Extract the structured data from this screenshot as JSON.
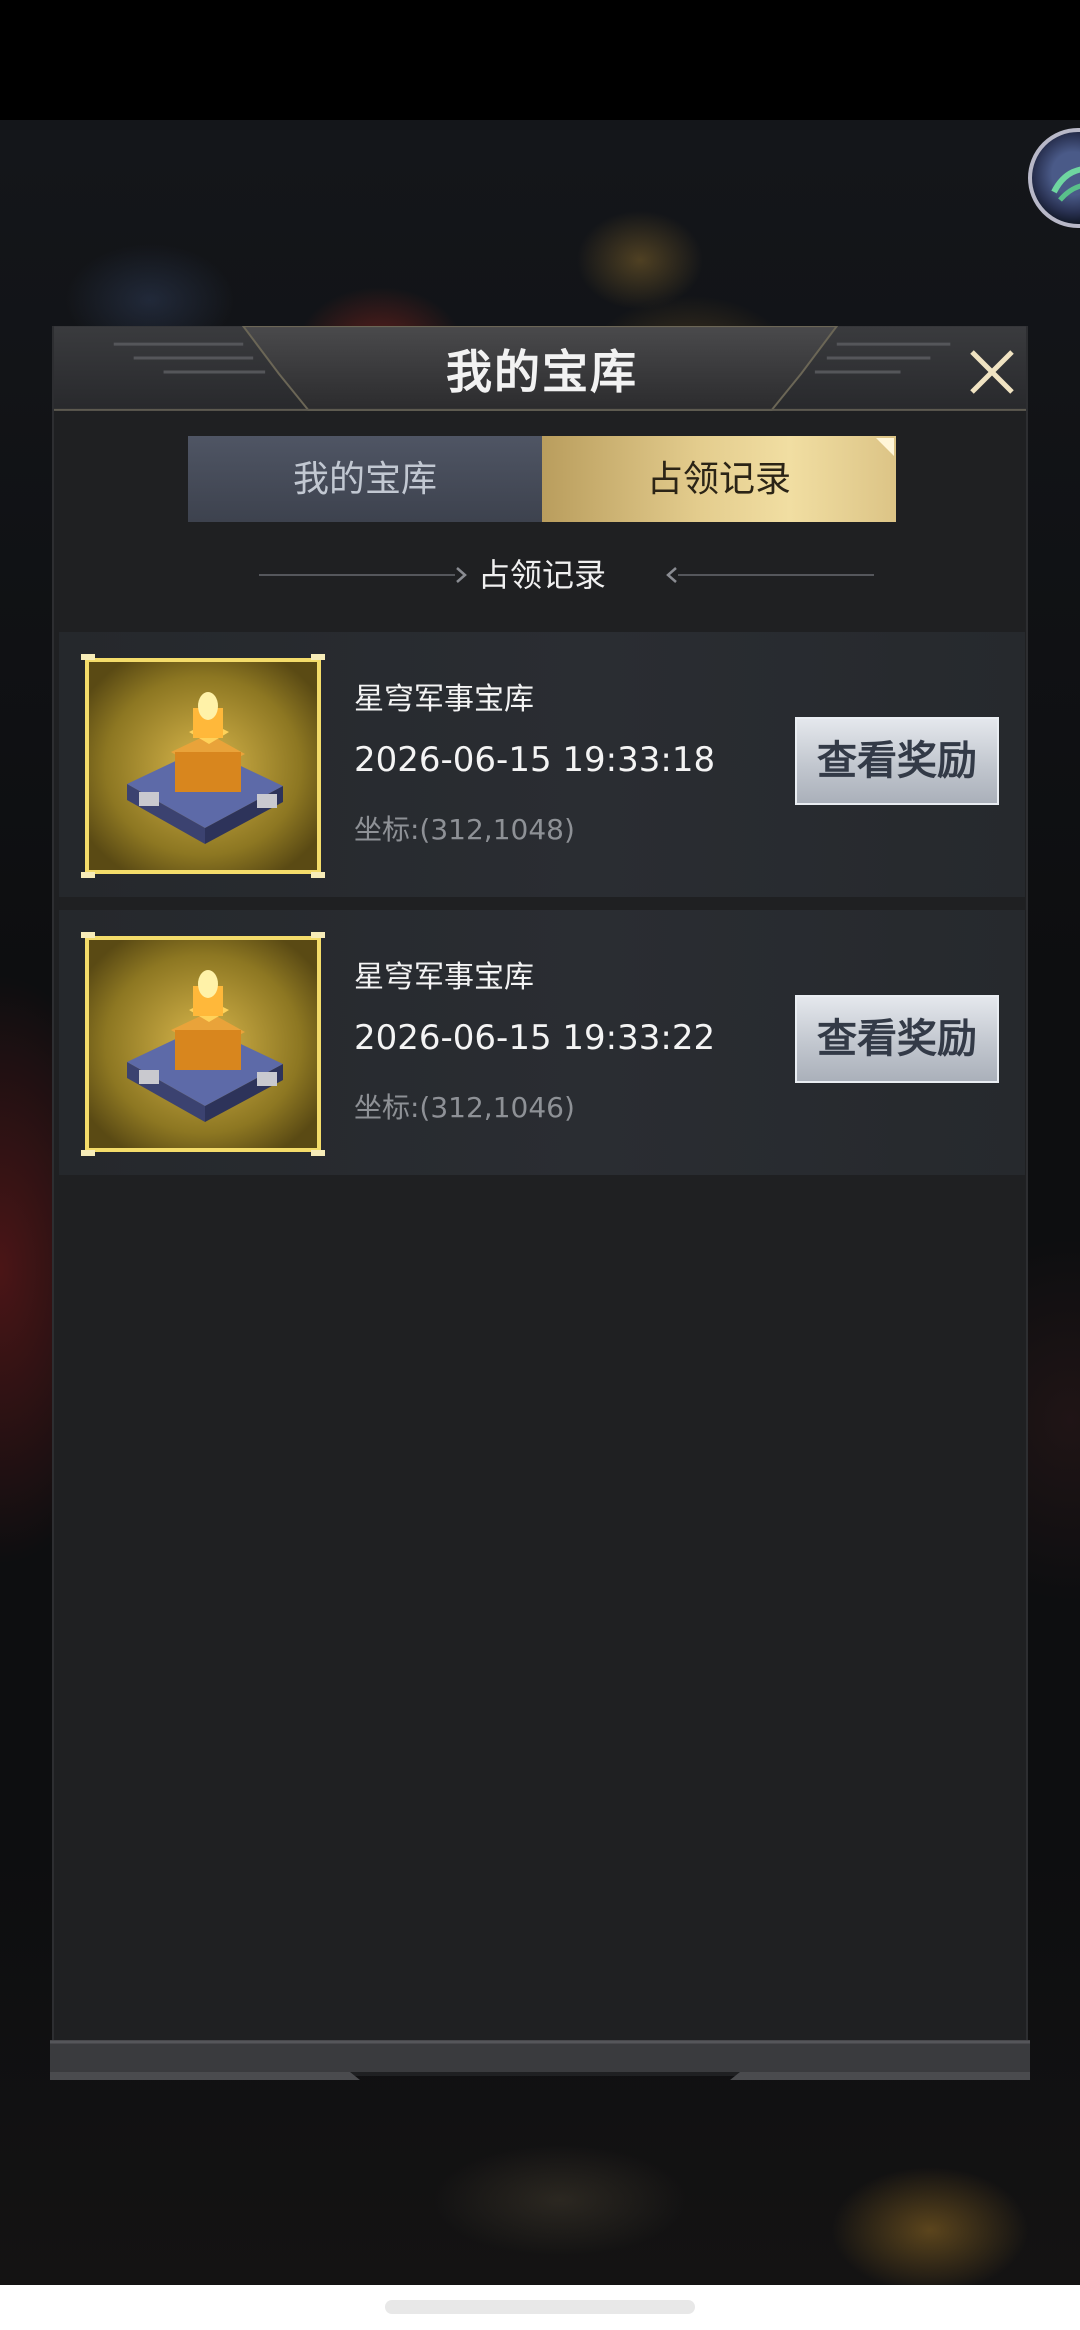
{
  "dialog": {
    "title": "我的宝库",
    "tabs": [
      {
        "label": "我的宝库",
        "active": false
      },
      {
        "label": "占领记录",
        "active": true
      }
    ],
    "section_heading": "占领记录"
  },
  "records": [
    {
      "name": "星穹军事宝库",
      "time": "2026-06-15 19:33:18",
      "coord": "坐标:(312,1048)",
      "button": "查看奖励",
      "icon": "golden-fortress-icon"
    },
    {
      "name": "星穹军事宝库",
      "time": "2026-06-15 19:33:22",
      "coord": "坐标:(312,1046)",
      "button": "查看奖励",
      "icon": "golden-fortress-icon"
    }
  ],
  "colors": {
    "accent_gold": "#e4cd8e",
    "panel_bg": "#1f2022",
    "inactive_tab": "#4f5564"
  }
}
